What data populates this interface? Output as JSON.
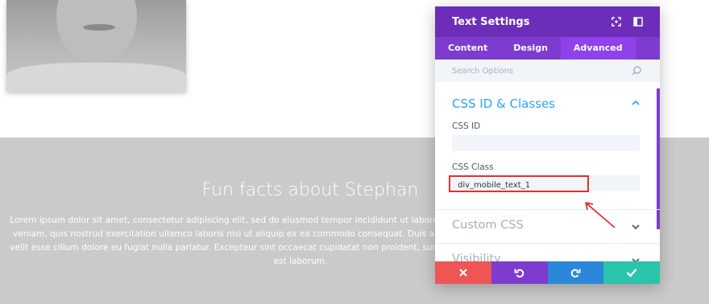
{
  "section": {
    "title": "Fun facts about Stephan",
    "body_lines": [
      "Lorem ipsum dolor sit amet, consectetur adipiscing elit, sed do eiusmod tempor incididunt ut labore e",
      "veniam, quis nostrud exercitation ullamco laboris nisi ut aliquip ex ea commodo consequat. Duis aut",
      "velit esse cillum dolore eu fugiat nulla pariatur. Excepteur sint occaecat cupidatat non proident, sunt i",
      "est laborum."
    ]
  },
  "panel": {
    "title": "Text Settings",
    "header_icons": [
      "focus-expand-icon",
      "sidebar-layout-icon"
    ],
    "tabs": [
      {
        "label": "Content",
        "active": false
      },
      {
        "label": "Design",
        "active": false
      },
      {
        "label": "Advanced",
        "active": true
      }
    ],
    "search_placeholder": "Search Options",
    "sections": {
      "css": {
        "title": "CSS ID & Classes",
        "css_id_label": "CSS ID",
        "css_id_value": "",
        "css_class_label": "CSS Class",
        "css_class_value": "div_mobile_text_1"
      },
      "custom_css": {
        "title": "Custom CSS"
      },
      "visibility": {
        "title": "Visibility"
      }
    },
    "footer_buttons": [
      {
        "icon": "close-icon",
        "color": "#ef5555"
      },
      {
        "icon": "undo-icon",
        "color": "#7e3bd0"
      },
      {
        "icon": "redo-icon",
        "color": "#2b87da"
      },
      {
        "icon": "check-icon",
        "color": "#29c4a9"
      }
    ]
  },
  "colors": {
    "header": "#6c2eb9",
    "tabs": "#7e3bd0",
    "active_tab": "#8f42ec",
    "section_accent": "#2ea3f2",
    "annotation": "#e0302f"
  }
}
